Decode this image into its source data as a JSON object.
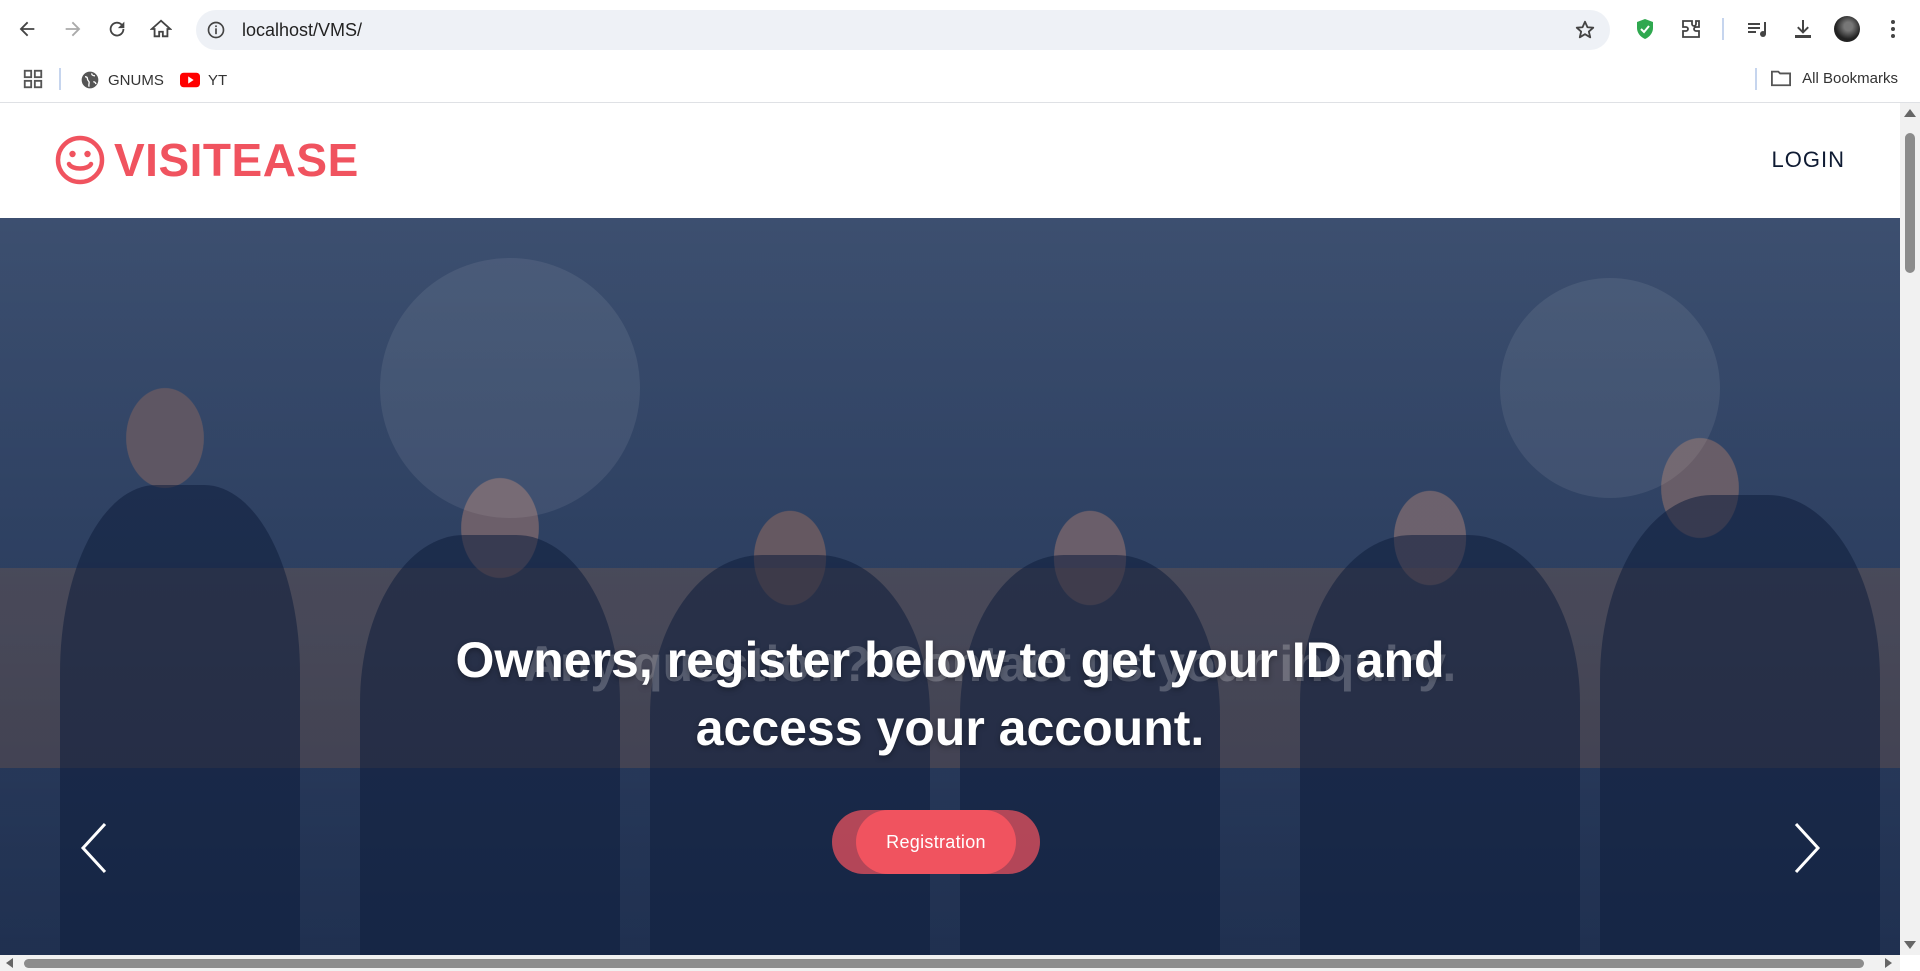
{
  "browser": {
    "url": "localhost/VMS/",
    "bookmarks": [
      {
        "label": "GNUMS",
        "icon": "globe-icon"
      },
      {
        "label": "YT",
        "icon": "youtube-icon"
      }
    ],
    "all_bookmarks_label": "All Bookmarks"
  },
  "site": {
    "brand_name": "VISITEASE",
    "brand_icon": "smile-icon",
    "login_label": "LOGIN",
    "brand_color": "#f0535f"
  },
  "hero": {
    "title": "Owners, register below to get your ID and access your account.",
    "ghost_title": "Any question? Contact us your inquiry.",
    "button_label": "Registration",
    "prev_icon": "chevron-left-icon",
    "next_icon": "chevron-right-icon"
  }
}
